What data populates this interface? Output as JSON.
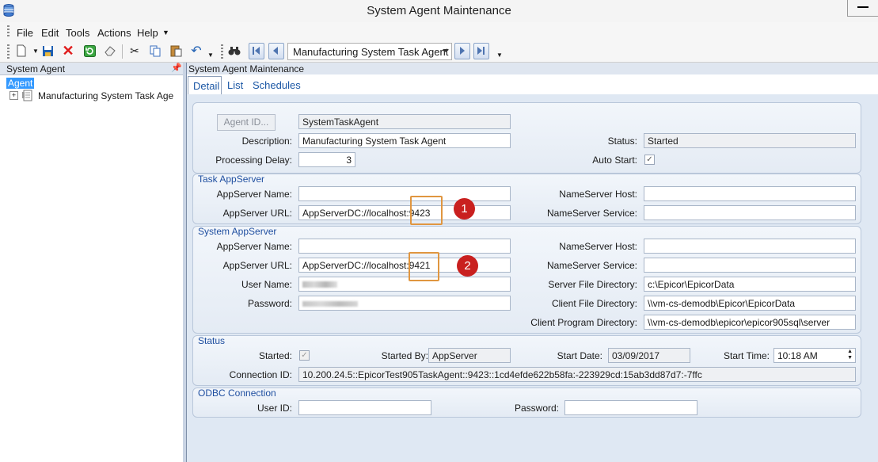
{
  "window": {
    "title": "System Agent Maintenance"
  },
  "menu": [
    "File",
    "Edit",
    "Tools",
    "Actions",
    "Help"
  ],
  "toolbar": {
    "selected_agent": "Manufacturing System Task Agent"
  },
  "tree": {
    "header": "System Agent",
    "root": "Agent",
    "child": "Manufacturing System Task Age"
  },
  "main": {
    "header": "System Agent Maintenance",
    "tabs": [
      "Detail",
      "List",
      "Schedules"
    ],
    "agent": {
      "id_button": "Agent ID...",
      "id_value": "SystemTaskAgent",
      "description_label": "Description:",
      "description": "Manufacturing System Task Agent",
      "delay_label": "Processing Delay:",
      "delay": "3",
      "status_label": "Status:",
      "status": "Started",
      "autostart_label": "Auto Start:",
      "autostart_checked": true
    },
    "task_appserver": {
      "title": "Task AppServer",
      "name_label": "AppServer Name:",
      "name": "",
      "url_label": "AppServer URL:",
      "url": "AppServerDC://localhost:9423",
      "ns_host_label": "NameServer Host:",
      "ns_host": "",
      "ns_service_label": "NameServer Service:",
      "ns_service": ""
    },
    "system_appserver": {
      "title": "System AppServer",
      "name_label": "AppServer Name:",
      "name": "",
      "url_label": "AppServer URL:",
      "url": "AppServerDC://localhost:9421",
      "user_label": "User Name:",
      "password_label": "Password:",
      "ns_host_label": "NameServer Host:",
      "ns_host": "",
      "ns_service_label": "NameServer Service:",
      "ns_service": "",
      "server_dir_label": "Server File Directory:",
      "server_dir": "c:\\Epicor\\EpicorData",
      "client_dir_label": "Client File Directory:",
      "client_dir": "\\\\vm-cs-demodb\\Epicor\\EpicorData",
      "client_prog_label": "Client Program Directory:",
      "client_prog": "\\\\vm-cs-demodb\\epicor\\epicor905sql\\server"
    },
    "status": {
      "title": "Status",
      "started_label": "Started:",
      "started_checked": true,
      "started_by_label": "Started By:",
      "started_by": "AppServer",
      "start_date_label": "Start Date:",
      "start_date": "03/09/2017",
      "start_time_label": "Start Time:",
      "start_time": "10:18 AM",
      "connection_label": "Connection ID:",
      "connection": "10.200.24.5::EpicorTest905TaskAgent::9423::1cd4efde622b58fa:-223929cd:15ab3dd87d7:-7ffc"
    },
    "odbc": {
      "title": "ODBC Connection",
      "user_label": "User ID:",
      "user": "",
      "password_label": "Password:",
      "password": ""
    }
  },
  "annotations": [
    "1",
    "2"
  ],
  "colors": {
    "accent": "#1f4fa0",
    "selection": "#3399ff",
    "highlight_box": "#e09640",
    "badge": "#c9201f"
  }
}
